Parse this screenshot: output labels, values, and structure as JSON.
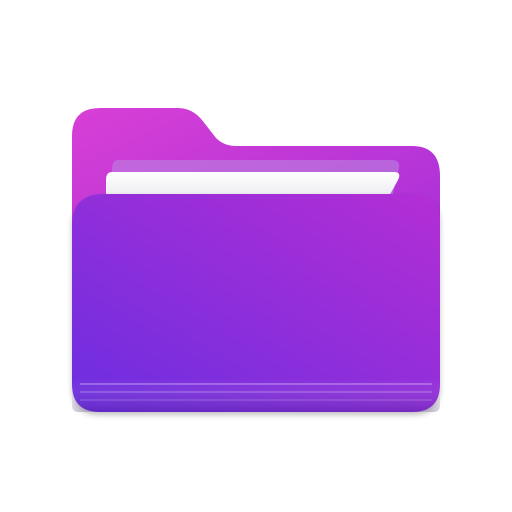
{
  "icon": {
    "name": "folder-icon",
    "colors": {
      "background": "#ffffff",
      "back_panel_start": "#d83fd6",
      "back_panel_end": "#a22fd8",
      "front_panel_start": "#6b2de0",
      "front_panel_end": "#b42fd5",
      "paper": "#f7f7f9",
      "paper_shadow": "#c9c2d6"
    }
  }
}
